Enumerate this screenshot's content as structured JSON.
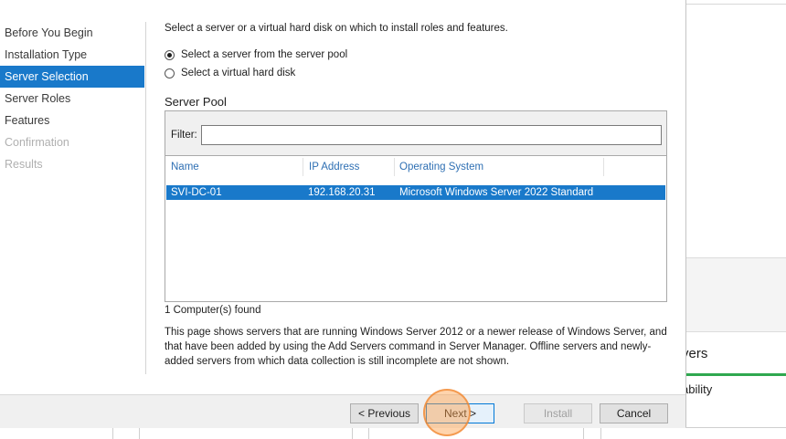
{
  "wizard": {
    "nav": [
      {
        "label": "Before You Begin",
        "state": "normal"
      },
      {
        "label": "Installation Type",
        "state": "normal"
      },
      {
        "label": "Server Selection",
        "state": "active"
      },
      {
        "label": "Server Roles",
        "state": "normal"
      },
      {
        "label": "Features",
        "state": "normal"
      },
      {
        "label": "Confirmation",
        "state": "disabled"
      },
      {
        "label": "Results",
        "state": "disabled"
      }
    ],
    "instruction": "Select a server or a virtual hard disk on which to install roles and features.",
    "options": [
      {
        "label": "Select a server from the server pool",
        "checked": true
      },
      {
        "label": "Select a virtual hard disk",
        "checked": false
      }
    ],
    "server_pool": {
      "title": "Server Pool",
      "filter_label": "Filter:",
      "filter_value": "",
      "columns": [
        "Name",
        "IP Address",
        "Operating System"
      ],
      "rows": [
        {
          "name": "SVI-DC-01",
          "ip": "192.168.20.31",
          "os": "Microsoft Windows Server 2022 Standard",
          "selected": true
        }
      ],
      "count_text": "1 Computer(s) found"
    },
    "description": "This page shows servers that are running Windows Server 2012 or a newer release of Windows Server, and that have been added by using the Add Servers command in Server Manager. Offline servers and newly-added servers from which data collection is still incomplete are not shown.",
    "buttons": {
      "previous": "< Previous",
      "next": "Next >",
      "install": "Install",
      "cancel": "Cancel"
    }
  },
  "background": {
    "tile_title_fragment": "vers",
    "tile_item_fragment": "ability",
    "accent_color": "#2fa84f"
  },
  "colors": {
    "selection": "#1979ca",
    "header_text": "#2e6fb3"
  }
}
